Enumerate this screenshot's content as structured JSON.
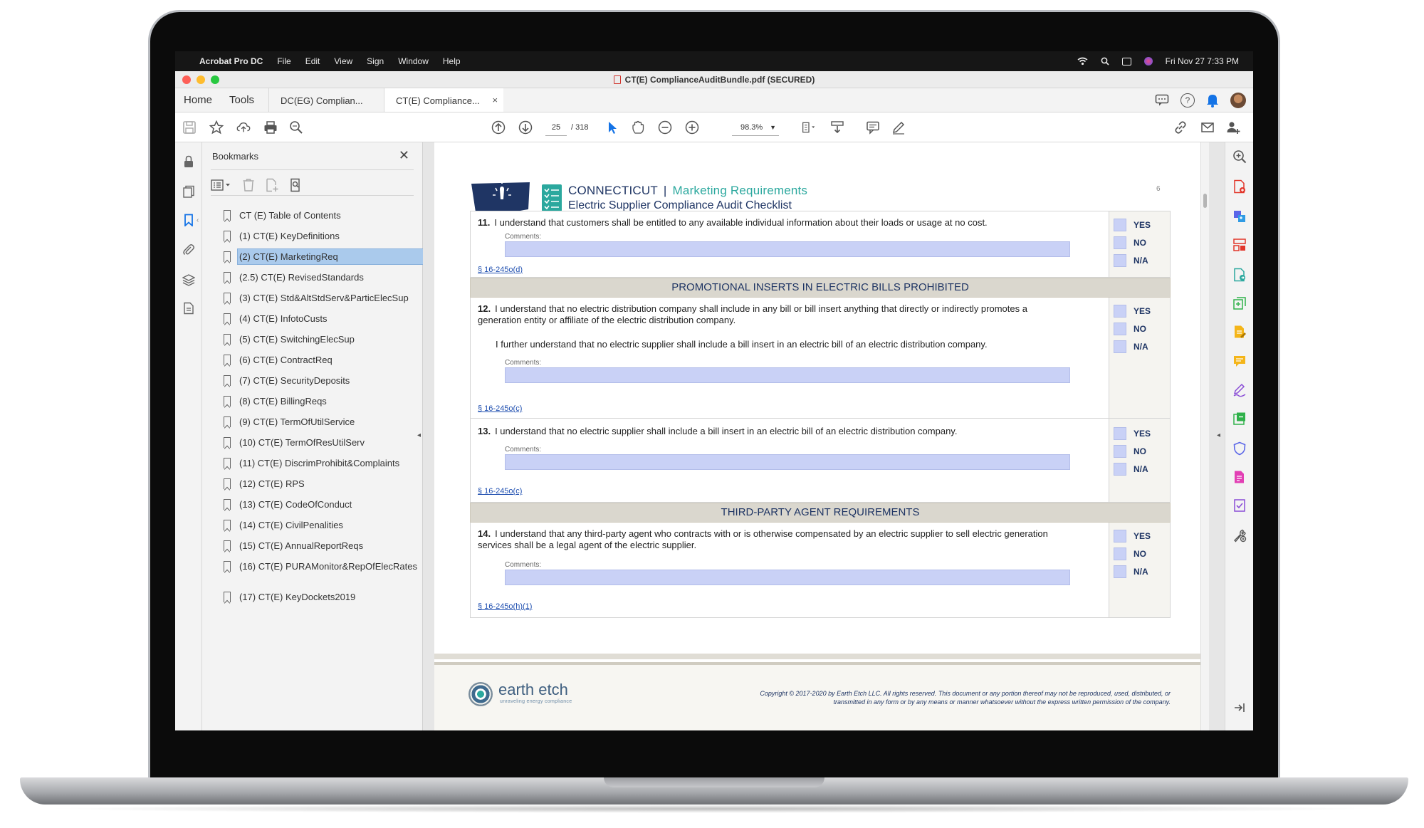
{
  "menubar": {
    "app_name": "Acrobat Pro DC",
    "items": [
      "File",
      "Edit",
      "View",
      "Sign",
      "Window",
      "Help"
    ],
    "clock": "Fri Nov 27  7:33 PM"
  },
  "window": {
    "title": "CT(E) ComplianceAuditBundle.pdf (SECURED)"
  },
  "tabs": {
    "home": "Home",
    "tools": "Tools",
    "doc_tabs": [
      {
        "label": "DC(EG) Complian...",
        "active": false
      },
      {
        "label": "CT(E) Compliance...",
        "active": true
      }
    ],
    "close_glyph": "×"
  },
  "toolbar": {
    "current_page": "25",
    "total_pages": "/  318",
    "zoom": "98.3%"
  },
  "bookmarks": {
    "title": "Bookmarks",
    "close_glyph": "✕",
    "items": [
      "CT (E) Table of Contents",
      "(1) CT(E) KeyDefinitions",
      "(2) CT(E) MarketingReq",
      "(2.5) CT(E) RevisedStandards",
      "(3) CT(E) Std&AltStdServ&ParticElecSup",
      "(4) CT(E) InfotoCusts",
      "(5) CT(E) SwitchingElecSup",
      "(6) CT(E) ContractReq",
      "(7) CT(E) SecurityDeposits",
      "(8) CT(E) BillingReqs",
      "(9) CT(E) TermOfUtilService",
      "(10) CT(E) TermOfResUtilServ",
      "(11) CT(E) DiscrimProhibit&Complaints",
      "(12) CT(E) RPS",
      "(13) CT(E) CodeOfConduct",
      "(14) CT(E) CivilPenalities",
      "(15) CT(E) AnnualReportReqs",
      "(16) CT(E) PURAMonitor&RepOfElecRates",
      "(17) CT(E) KeyDockets2019"
    ],
    "selected_index": 2
  },
  "document": {
    "state": "CONNECTICUT",
    "separator": "|",
    "section": "Marketing Requirements",
    "subtitle": "Electric Supplier Compliance Audit Checklist",
    "page_number": "6",
    "comments_label": "Comments:",
    "answers": [
      "YES",
      "NO",
      "N/A"
    ],
    "questions": [
      {
        "num": "11.",
        "text": "I understand that customers shall be entitled to any available individual information about their loads or usage at no cost.",
        "text2": "",
        "ref": "§ 16-245o(d)"
      },
      {
        "num": "12.",
        "text": "I understand that no electric distribution company shall include in any bill or bill insert anything that directly or indirectly promotes a generation entity or affiliate of the electric distribution company.",
        "text2": "I further understand that no electric supplier shall include a bill insert in an electric bill of an electric distribution company.",
        "ref": "§ 16-245o(c)"
      },
      {
        "num": "13.",
        "text": "I understand that no electric supplier shall include a bill insert in an electric bill of an electric distribution company.",
        "text2": "",
        "ref": "§ 16-245o(c)"
      },
      {
        "num": "14.",
        "text": "I understand that any third-party agent who contracts with or is otherwise compensated by an electric supplier to sell electric generation services shall be a legal agent of the electric supplier.",
        "text2": "",
        "ref": "§ 16-245o(h)(1)"
      }
    ],
    "section_bands": [
      "PROMOTIONAL INSERTS IN ELECTRIC BILLS PROHIBITED",
      "THIRD-PARTY AGENT REQUIREMENTS"
    ],
    "footer": {
      "brand": "earth etch",
      "tagline": "unraveling energy compliance",
      "copyright": "Copyright © 2017-2020 by Earth Etch LLC.  All rights reserved.  This document or any portion thereof may not be reproduced, used, distributed, or transmitted in any form or by any means or manner whatsoever without the express written permission of the company."
    }
  },
  "colors": {
    "navy": "#1f3564",
    "teal": "#2ba89e",
    "field_fill": "#c9d1f6",
    "band": "#dad7ce",
    "selection": "#aacaec"
  }
}
